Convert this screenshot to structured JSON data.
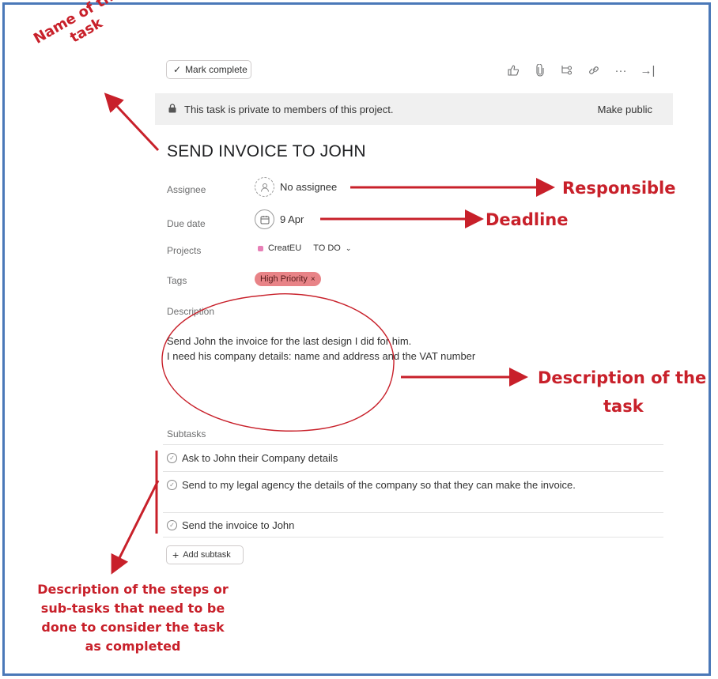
{
  "toolbar": {
    "mark_complete": "Mark complete",
    "icons": [
      "thumbs-up-icon",
      "paperclip-icon",
      "subtask-icon",
      "link-icon",
      "more-icon",
      "close-pane-icon"
    ]
  },
  "banner": {
    "text": "This task is private to members of this project.",
    "action": "Make public"
  },
  "task": {
    "title": "SEND INVOICE TO JOHN",
    "assignee_label": "Assignee",
    "assignee_value": "No assignee",
    "due_label": "Due date",
    "due_value": "9 Apr",
    "projects_label": "Projects",
    "project_name": "CreatEU",
    "project_section": "TO DO",
    "tags_label": "Tags",
    "tag": "High Priority",
    "description_label": "Description",
    "description_line1": "Send John the invoice for the last design I did for him.",
    "description_line2": "I need his company details: name and address  and the VAT number",
    "subtasks_label": "Subtasks",
    "subtasks": [
      "Ask to John their Company details",
      "Send to my legal agency the details of the company so that they can make the invoice.",
      "Send the invoice to John"
    ],
    "add_subtask": "Add subtask"
  },
  "annotations": {
    "name_of_task": "Name of the task",
    "responsible": "Responsible",
    "deadline": "Deadline",
    "description_of_task_line1": "Description of the",
    "description_of_task_line2": "task",
    "steps_line1": "Description of the steps or",
    "steps_line2": "sub-tasks that need to be",
    "steps_line3": "done to consider the task",
    "steps_line4": "as completed"
  },
  "colors": {
    "annotation": "#c8202a",
    "frame": "#4a78b8",
    "tag_bg": "#e88387",
    "project_dot": "#e77fb6"
  }
}
